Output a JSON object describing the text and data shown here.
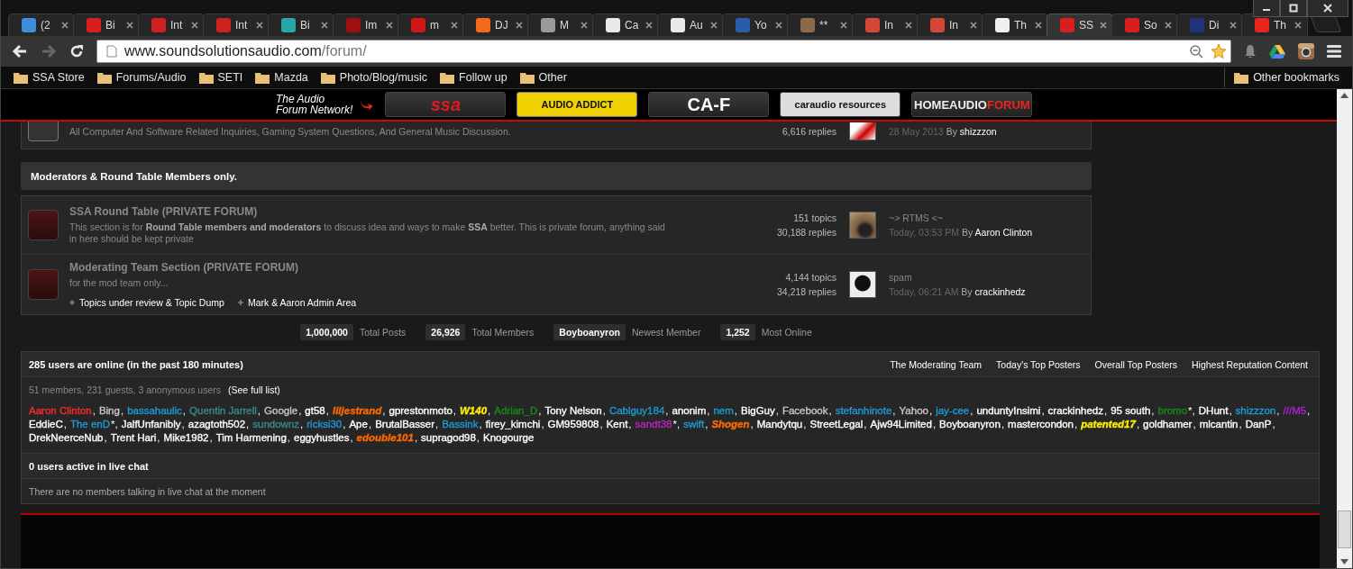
{
  "tabs": [
    {
      "title": "(2",
      "color": "#3a8fd8",
      "selected": false
    },
    {
      "title": "Bi",
      "color": "#d81e1e",
      "selected": false
    },
    {
      "title": "Int",
      "color": "#cc2222",
      "selected": false
    },
    {
      "title": "Int",
      "color": "#cc2222",
      "selected": false
    },
    {
      "title": "Bi",
      "color": "#2aa6a6",
      "selected": false
    },
    {
      "title": "Im",
      "color": "#a01010",
      "selected": false
    },
    {
      "title": "m",
      "color": "#d01818",
      "selected": false
    },
    {
      "title": "DJ",
      "color": "#f26b1d",
      "selected": false
    },
    {
      "title": "M",
      "color": "#9a9a9a",
      "selected": false
    },
    {
      "title": "Ca",
      "color": "#e8e8e8",
      "selected": false
    },
    {
      "title": "Au",
      "color": "#e8e8e8",
      "selected": false
    },
    {
      "title": "Yo",
      "color": "#2a5ca8",
      "selected": false
    },
    {
      "title": "**",
      "color": "#8a6a4a",
      "selected": false
    },
    {
      "title": "In",
      "color": "#d44638",
      "selected": false
    },
    {
      "title": "In",
      "color": "#d44638",
      "selected": false
    },
    {
      "title": "Th",
      "color": "#f0f0f0",
      "selected": false
    },
    {
      "title": "SS",
      "color": "#d81e1e",
      "selected": true
    },
    {
      "title": "So",
      "color": "#d81e1e",
      "selected": false
    },
    {
      "title": "Di",
      "color": "#23337a",
      "selected": false
    },
    {
      "title": "Th",
      "color": "#e8261e",
      "selected": false
    }
  ],
  "address": {
    "host": "www.soundsolutionsaudio.com",
    "path": "/forum/"
  },
  "bookmarks": [
    "SSA Store",
    "Forums/Audio",
    "SETI",
    "Mazda",
    "Photo/Blog/music",
    "Follow up",
    "Other"
  ],
  "other_bookmarks": "Other bookmarks",
  "network": {
    "tagline_1": "The Audio",
    "tagline_2": "Forum Network!",
    "logos": [
      {
        "text": "ssa",
        "kind": "ssa"
      },
      {
        "text": "AUDIO ADDICT",
        "kind": "addict"
      },
      {
        "text": "CA-F",
        "kind": "caf"
      },
      {
        "text": "caraudio resources",
        "kind": "car"
      },
      {
        "text": "HOMEAUDIO",
        "accent": "FORUM",
        "kind": "home"
      }
    ]
  },
  "partial_forum": {
    "description": "All Computer And Software Related Inquiries, Gaming System Questions, And General Music Discussion.",
    "replies": "6,616 replies",
    "date": "28 May 2013",
    "by": "By",
    "author": "shizzzon"
  },
  "category": {
    "title": "Moderators & Round Table Members only.",
    "forums": [
      {
        "title": "SSA Round Table (PRIVATE FORUM)",
        "description": "This section is for **Round Table members and moderators** to discuss idea and ways to make **SSA** better. This is private forum, anything said in here should be kept private",
        "topics": "151 topics",
        "replies": "30,188 replies",
        "last_title": "~> RTMS <~",
        "last_date": "Today, 03:53 PM",
        "by": "By",
        "author": "Aaron Clinton"
      },
      {
        "title": "Moderating Team Section (PRIVATE FORUM)",
        "description": "for the mod team only...",
        "subforums": [
          "Topics under review & Topic Dump",
          "Mark & Aaron Admin Area"
        ],
        "topics": "4,144 topics",
        "replies": "34,218 replies",
        "last_title": "spam",
        "last_date": "Today, 06:21 AM",
        "by": "By",
        "author": "crackinhedz"
      }
    ]
  },
  "stats": [
    {
      "value": "1,000,000",
      "label": "Total Posts"
    },
    {
      "value": "26,926",
      "label": "Total Members"
    },
    {
      "value": "Boyboanyron",
      "label": "Newest Member"
    },
    {
      "value": "1,252",
      "label": "Most Online"
    }
  ],
  "online": {
    "title": "285 users are online (in the past 180 minutes)",
    "links": [
      "The Moderating Team",
      "Today's Top Posters",
      "Overall Top Posters",
      "Highest Reputation Content"
    ],
    "summary": "51 members, 231 guests, 3 anonymous users",
    "full_list": "(See full list)",
    "users": [
      {
        "name": "Aaron Clinton",
        "color": "#ff2a2a",
        "emphasis": false,
        "after": ","
      },
      {
        "name": "Bing",
        "color": "#c8c8c8",
        "emphasis": false,
        "after": ","
      },
      {
        "name": "bassahaulic",
        "color": "#1e9ad6",
        "emphasis": false,
        "after": ","
      },
      {
        "name": "Quentin Jarrell",
        "color": "#3a8a8a",
        "emphasis": false,
        "after": ","
      },
      {
        "name": "Google",
        "color": "#c8c8c8",
        "emphasis": false,
        "after": ","
      },
      {
        "name": "gt58",
        "color": "#ffffff",
        "emphasis": false,
        "after": ","
      },
      {
        "name": "liljestrand",
        "color": "#ff6a00",
        "emphasis": true,
        "after": ","
      },
      {
        "name": "gprestonmoto",
        "color": "#ffffff",
        "emphasis": false,
        "after": ","
      },
      {
        "name": "W140",
        "color": "#ffee00",
        "emphasis": true,
        "after": ","
      },
      {
        "name": "Adrian_D",
        "color": "#1a8a1a",
        "emphasis": false,
        "after": ","
      },
      {
        "name": "Tony Nelson",
        "color": "#ffffff",
        "emphasis": false,
        "after": ","
      },
      {
        "name": "Cablguy184",
        "color": "#1e9ad6",
        "emphasis": false,
        "after": ","
      },
      {
        "name": "anonim",
        "color": "#ffffff",
        "emphasis": false,
        "after": ","
      },
      {
        "name": "nem",
        "color": "#1e9ad6",
        "emphasis": false,
        "after": ","
      },
      {
        "name": "BigGuy",
        "color": "#ffffff",
        "emphasis": false,
        "after": ","
      },
      {
        "name": "Facebook",
        "color": "#c8c8c8",
        "emphasis": false,
        "after": ","
      },
      {
        "name": "stefanhinote",
        "color": "#1e9ad6",
        "emphasis": false,
        "after": ","
      },
      {
        "name": "Yahoo",
        "color": "#c8c8c8",
        "emphasis": false,
        "after": ","
      },
      {
        "name": "jay-cee",
        "color": "#1e9ad6",
        "emphasis": false,
        "after": ","
      },
      {
        "name": "unduntyInsimi",
        "color": "#ffffff",
        "emphasis": false,
        "after": ","
      },
      {
        "name": "crackinhedz",
        "color": "#ffffff",
        "emphasis": false,
        "after": ","
      },
      {
        "name": "95 south",
        "color": "#ffffff",
        "emphasis": false,
        "after": ","
      },
      {
        "name": "bromo",
        "color": "#1a8a1a",
        "emphasis": false,
        "after": "*,"
      },
      {
        "name": "DHunt",
        "color": "#ffffff",
        "emphasis": false,
        "after": ","
      },
      {
        "name": "shizzzon",
        "color": "#1e9ad6",
        "emphasis": false,
        "after": ","
      },
      {
        "name": "///M5",
        "color": "#b020d0",
        "emphasis": false,
        "after": ","
      },
      {
        "name": "EddieC",
        "color": "#ffffff",
        "emphasis": false,
        "after": ","
      },
      {
        "name": "The enD",
        "color": "#1e9ad6",
        "emphasis": false,
        "after": "*,"
      },
      {
        "name": "JalfUnfanibly",
        "color": "#ffffff",
        "emphasis": false,
        "after": ","
      },
      {
        "name": "azagtoth502",
        "color": "#ffffff",
        "emphasis": false,
        "after": ","
      },
      {
        "name": "sundownz",
        "color": "#3a8a8a",
        "emphasis": false,
        "after": ","
      },
      {
        "name": "ricksi30",
        "color": "#1e9ad6",
        "emphasis": false,
        "after": ","
      },
      {
        "name": "Ape",
        "color": "#ffffff",
        "emphasis": false,
        "after": ","
      },
      {
        "name": "BrutalBasser",
        "color": "#ffffff",
        "emphasis": false,
        "after": ","
      },
      {
        "name": "Bassink",
        "color": "#1e9ad6",
        "emphasis": false,
        "after": ","
      },
      {
        "name": "firey_kimchi",
        "color": "#ffffff",
        "emphasis": false,
        "after": ","
      },
      {
        "name": "GM959808",
        "color": "#ffffff",
        "emphasis": false,
        "after": ","
      },
      {
        "name": "Kent",
        "color": "#ffffff",
        "emphasis": false,
        "after": ","
      },
      {
        "name": "sandt38",
        "color": "#c020c0",
        "emphasis": false,
        "after": "*,"
      },
      {
        "name": "swift",
        "color": "#1e9ad6",
        "emphasis": false,
        "after": ","
      },
      {
        "name": "Shogen",
        "color": "#ff6a00",
        "emphasis": true,
        "after": ","
      },
      {
        "name": "Mandytqu",
        "color": "#ffffff",
        "emphasis": false,
        "after": ","
      },
      {
        "name": "StreetLegal",
        "color": "#ffffff",
        "emphasis": false,
        "after": ","
      },
      {
        "name": "Ajw94Limited",
        "color": "#ffffff",
        "emphasis": false,
        "after": ","
      },
      {
        "name": "Boyboanyron",
        "color": "#ffffff",
        "emphasis": false,
        "after": ","
      },
      {
        "name": "mastercondon",
        "color": "#ffffff",
        "emphasis": false,
        "after": ","
      },
      {
        "name": "patented17",
        "color": "#ffee00",
        "emphasis": true,
        "after": ","
      },
      {
        "name": "goldhamer",
        "color": "#ffffff",
        "emphasis": false,
        "after": ","
      },
      {
        "name": "mlcantin",
        "color": "#ffffff",
        "emphasis": false,
        "after": ","
      },
      {
        "name": "DanP",
        "color": "#ffffff",
        "emphasis": false,
        "after": ","
      },
      {
        "name": "DrekNeerceNub",
        "color": "#ffffff",
        "emphasis": false,
        "after": ","
      },
      {
        "name": "Trent Hari",
        "color": "#ffffff",
        "emphasis": false,
        "after": ","
      },
      {
        "name": "Mike1982",
        "color": "#ffffff",
        "emphasis": false,
        "after": ","
      },
      {
        "name": "Tim Harmening",
        "color": "#ffffff",
        "emphasis": false,
        "after": ","
      },
      {
        "name": "eggyhustles",
        "color": "#ffffff",
        "emphasis": false,
        "after": ","
      },
      {
        "name": "edouble101",
        "color": "#ff6a00",
        "emphasis": true,
        "after": ","
      },
      {
        "name": "supragod98",
        "color": "#ffffff",
        "emphasis": false,
        "after": ","
      },
      {
        "name": "Knogourge",
        "color": "#ffffff",
        "emphasis": false
      }
    ],
    "chat_title": "0 users active in live chat",
    "chat_text": "There are no members talking in live chat at the moment"
  }
}
